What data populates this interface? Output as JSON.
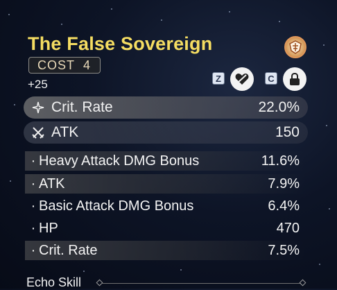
{
  "echo": {
    "name": "The False Sovereign",
    "cost_label": "COST",
    "cost_value": "4",
    "level": "+25"
  },
  "controls": {
    "discard_key": "Z",
    "lock_key": "C",
    "discard_icon": "broken-heart-icon",
    "lock_icon": "lock-icon"
  },
  "main_stats": [
    {
      "label": "Crit. Rate",
      "value": "22.0%",
      "icon": "crit-star-icon"
    },
    {
      "label": "ATK",
      "value": "150",
      "icon": "crossed-swords-icon"
    }
  ],
  "sub_stats": [
    {
      "bullet": "·",
      "label": "Heavy Attack DMG Bonus",
      "value": "11.6%"
    },
    {
      "bullet": "·",
      "label": "ATK",
      "value": "7.9%"
    },
    {
      "bullet": "·",
      "label": "Basic Attack DMG Bonus",
      "value": "6.4%"
    },
    {
      "bullet": "·",
      "label": "HP",
      "value": "470"
    },
    {
      "bullet": "·",
      "label": "Crit. Rate",
      "value": "7.5%"
    }
  ],
  "section": {
    "echo_skill_label": "Echo Skill"
  },
  "colors": {
    "title": "#f5dd62",
    "background": "#0d1426"
  }
}
